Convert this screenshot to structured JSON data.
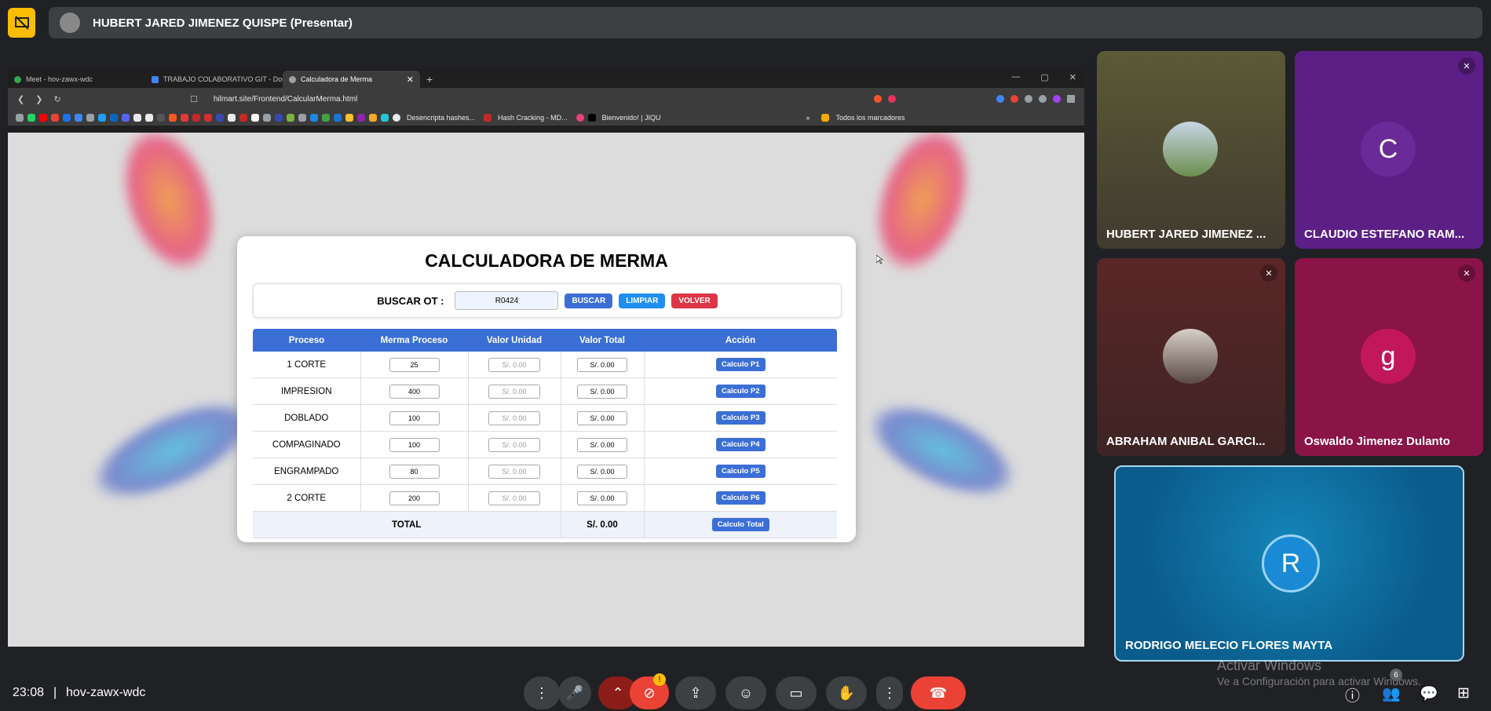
{
  "presenter": {
    "name": "HUBERT JARED JIMENEZ QUISPE (Presentar)"
  },
  "browser": {
    "tabs": [
      {
        "label": "Meet - hov-zawx-wdc"
      },
      {
        "label": "TRABAJO COLABORATIVO GIT - Doc"
      },
      {
        "label": "Calculadora de Merma"
      }
    ],
    "url": "hilmart.site/Frontend/CalcularMerma.html",
    "bookmarks": [
      {
        "label": "Desencripta hashes..."
      },
      {
        "label": "Hash Cracking - MD..."
      },
      {
        "label": "Bienvenido! | JIQU"
      },
      {
        "label": "Todos los marcadores"
      }
    ]
  },
  "page": {
    "title": "CALCULADORA DE MERMA",
    "search_label": "BUSCAR OT :",
    "ot_value": "R0424",
    "buscar_label": "BUSCAR",
    "limpiar_label": "LIMPIAR",
    "volver_label": "VOLVER",
    "columns": [
      "Proceso",
      "Merma Proceso",
      "Valor Unidad",
      "Valor Total",
      "Acción"
    ],
    "rows": [
      {
        "proceso": "1 CORTE",
        "merma": "25",
        "unidad": "S/. 0.00",
        "total": "S/. 0.00",
        "accion": "Calculo P1"
      },
      {
        "proceso": "IMPRESION",
        "merma": "400",
        "unidad": "S/. 0.00",
        "total": "S/. 0.00",
        "accion": "Calculo P2"
      },
      {
        "proceso": "DOBLADO",
        "merma": "100",
        "unidad": "S/. 0.00",
        "total": "S/. 0.00",
        "accion": "Calculo P3"
      },
      {
        "proceso": "COMPAGINADO",
        "merma": "100",
        "unidad": "S/. 0.00",
        "total": "S/. 0.00",
        "accion": "Calculo P4"
      },
      {
        "proceso": "ENGRAMPADO",
        "merma": "80",
        "unidad": "S/. 0.00",
        "total": "S/. 0.00",
        "accion": "Calculo P5"
      },
      {
        "proceso": "2 CORTE",
        "merma": "200",
        "unidad": "S/. 0.00",
        "total": "S/. 0.00",
        "accion": "Calculo P6"
      }
    ],
    "total_label": "TOTAL",
    "total_value": "S/. 0.00",
    "total_button": "Calculo Total"
  },
  "participants": [
    {
      "name": "HUBERT JARED JIMENEZ ...",
      "initial": "",
      "color": "#5b5a35"
    },
    {
      "name": "CLAUDIO ESTEFANO RAM...",
      "initial": "C",
      "color": "#5b1f86"
    },
    {
      "name": "ABRAHAM ANIBAL GARCI...",
      "initial": "",
      "color": "#5a2626"
    },
    {
      "name": "Oswaldo Jimenez Dulanto",
      "initial": "g",
      "color": "#8a1448"
    },
    {
      "name": "RODRIGO MELECIO FLORES MAYTA",
      "initial": "R",
      "color": "#0a5c8c"
    }
  ],
  "bottom": {
    "time": "23:08",
    "meeting_code": "hov-zawx-wdc",
    "watermark_title": "Activar Windows",
    "watermark_sub": "Ve a Configuración para activar Windows.",
    "people_count": "6"
  }
}
